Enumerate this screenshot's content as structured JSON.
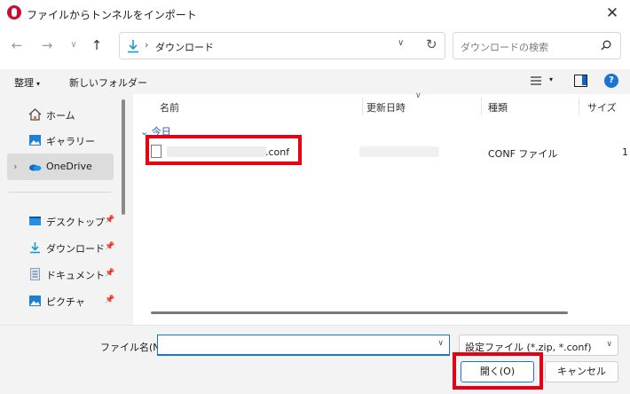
{
  "window": {
    "title": "ファイルからトンネルをインポート",
    "close_label": "✕"
  },
  "address": {
    "current_folder": "ダウンロード",
    "separator": "›"
  },
  "search": {
    "placeholder": "ダウンロードの検索"
  },
  "toolbar": {
    "organize_label": "整理",
    "new_folder_label": "新しいフォルダー"
  },
  "sidebar": {
    "items": [
      {
        "label": "ホーム",
        "icon": "home-icon"
      },
      {
        "label": "ギャラリー",
        "icon": "gallery-icon"
      },
      {
        "label": "OneDrive",
        "icon": "onedrive-icon"
      },
      {
        "label": "デスクトップ",
        "icon": "desktop-icon"
      },
      {
        "label": "ダウンロード",
        "icon": "download-icon"
      },
      {
        "label": "ドキュメント",
        "icon": "documents-icon"
      },
      {
        "label": "ピクチャ",
        "icon": "pictures-icon"
      }
    ]
  },
  "columns": {
    "name": "名前",
    "modified": "更新日時",
    "type": "種類",
    "size": "サイズ"
  },
  "files": {
    "group_label": "今日",
    "rows": [
      {
        "name_visible": ".conf",
        "type": "CONF ファイル",
        "size": "1"
      }
    ]
  },
  "footer": {
    "filename_label": "ファイル名(N):",
    "filename_value": "",
    "filetype_selected": "設定ファイル (*.zip, *.conf)",
    "open_button": "開く(O)",
    "cancel_button": "キャンセル"
  },
  "colors": {
    "accent": "#1a73d9",
    "highlight_red": "#e60012"
  }
}
